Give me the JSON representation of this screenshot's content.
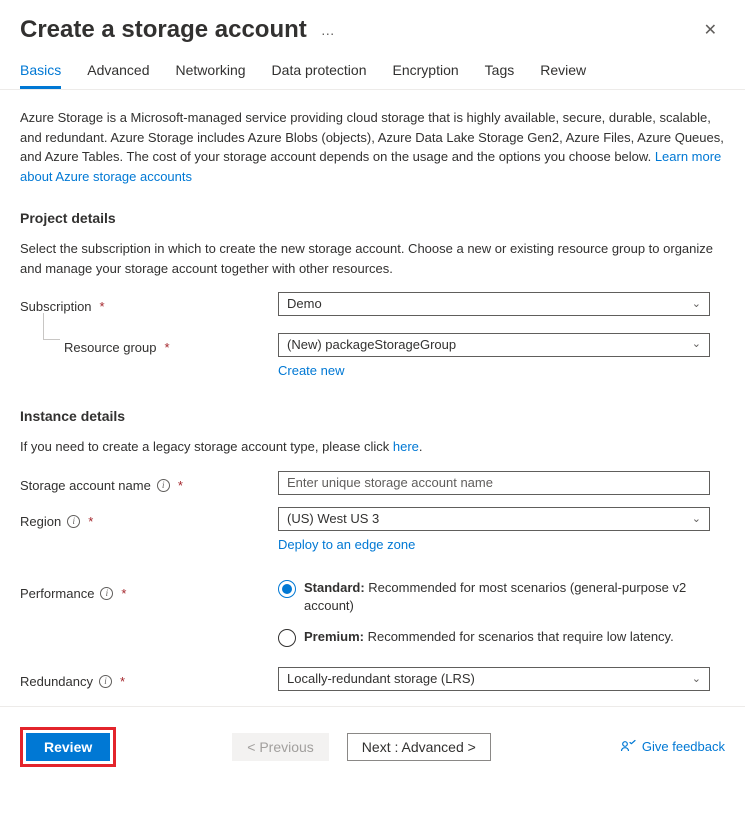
{
  "header": {
    "title": "Create a storage account",
    "more_label": "…"
  },
  "tabs": [
    "Basics",
    "Advanced",
    "Networking",
    "Data protection",
    "Encryption",
    "Tags",
    "Review"
  ],
  "active_tab": 0,
  "intro": {
    "text": "Azure Storage is a Microsoft-managed service providing cloud storage that is highly available, secure, durable, scalable, and redundant. Azure Storage includes Azure Blobs (objects), Azure Data Lake Storage Gen2, Azure Files, Azure Queues, and Azure Tables. The cost of your storage account depends on the usage and the options you choose below. ",
    "link": "Learn more about Azure storage accounts"
  },
  "sections": {
    "project": {
      "title": "Project details",
      "subtitle": "Select the subscription in which to create the new storage account. Choose a new or existing resource group to organize and manage your storage account together with other resources.",
      "subscription": {
        "label": "Subscription",
        "value": "Demo"
      },
      "resource_group": {
        "label": "Resource group",
        "value": "(New) packageStorageGroup",
        "create_link": "Create new"
      }
    },
    "instance": {
      "title": "Instance details",
      "legacy_text": "If you need to create a legacy storage account type, please click ",
      "legacy_link": "here",
      "name": {
        "label": "Storage account name",
        "placeholder": "Enter unique storage account name"
      },
      "region": {
        "label": "Region",
        "value": "(US) West US 3",
        "deploy_link": "Deploy to an edge zone"
      },
      "performance": {
        "label": "Performance",
        "standard_bold": "Standard:",
        "standard_rest": " Recommended for most scenarios (general-purpose v2 account)",
        "premium_bold": "Premium:",
        "premium_rest": " Recommended for scenarios that require low latency.",
        "selected": "standard"
      },
      "redundancy": {
        "label": "Redundancy",
        "value": "Locally-redundant storage (LRS)"
      }
    }
  },
  "footer": {
    "review": "Review",
    "previous": "< Previous",
    "next": "Next : Advanced >",
    "feedback": "Give feedback"
  }
}
